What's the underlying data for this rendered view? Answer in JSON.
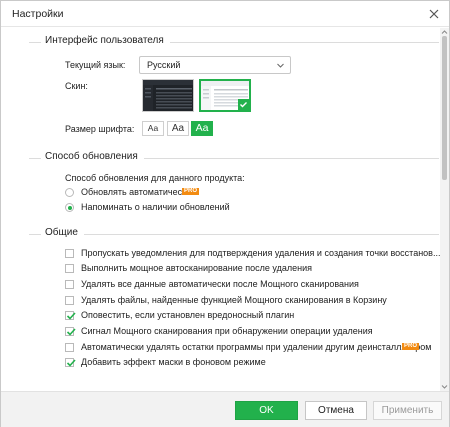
{
  "window": {
    "title": "Настройки"
  },
  "interface": {
    "section_title": "Интерфейс пользователя",
    "language_label": "Текущий язык:",
    "language_value": "Русский",
    "skin_label": "Скин:",
    "font_size_label": "Размер шрифта:",
    "font_sizes": [
      "Aa",
      "Aa",
      "Aa"
    ]
  },
  "update": {
    "section_title": "Способ обновления",
    "description": "Способ обновления для данного продукта:",
    "options": [
      {
        "label": "Обновлять автоматически",
        "pro": "PRO",
        "selected": false
      },
      {
        "label": "Напоминать о наличии обновлений",
        "selected": true
      }
    ]
  },
  "general": {
    "section_title": "Общие",
    "options": [
      {
        "label": "Пропускать уведомления для подтверждения удаления и создания точки восстанов...",
        "checked": false
      },
      {
        "label": "Выполнить мощное автосканирование после удаления",
        "checked": false
      },
      {
        "label": "Удалять все данные автоматически после Мощного сканирования",
        "checked": false
      },
      {
        "label": "Удалять файлы, найденные функцией Мощного сканирования в Корзину",
        "checked": false
      },
      {
        "label": "Оповестить, если установлен вредоносный плагин",
        "checked": true
      },
      {
        "label": "Сигнал Мощного сканирования при обнаружении операции удаления",
        "checked": true
      },
      {
        "label": "Автоматически удалять остатки программы при удалении другим деинсталлятором",
        "pro": "PRO",
        "checked": false
      },
      {
        "label": "Добавить эффект маски в фоновом режиме",
        "checked": true
      }
    ]
  },
  "footer": {
    "ok": "OK",
    "cancel": "Отмена",
    "apply": "Применить"
  },
  "colors": {
    "accent": "#22b14c",
    "pro_badge": "#f28b12"
  }
}
